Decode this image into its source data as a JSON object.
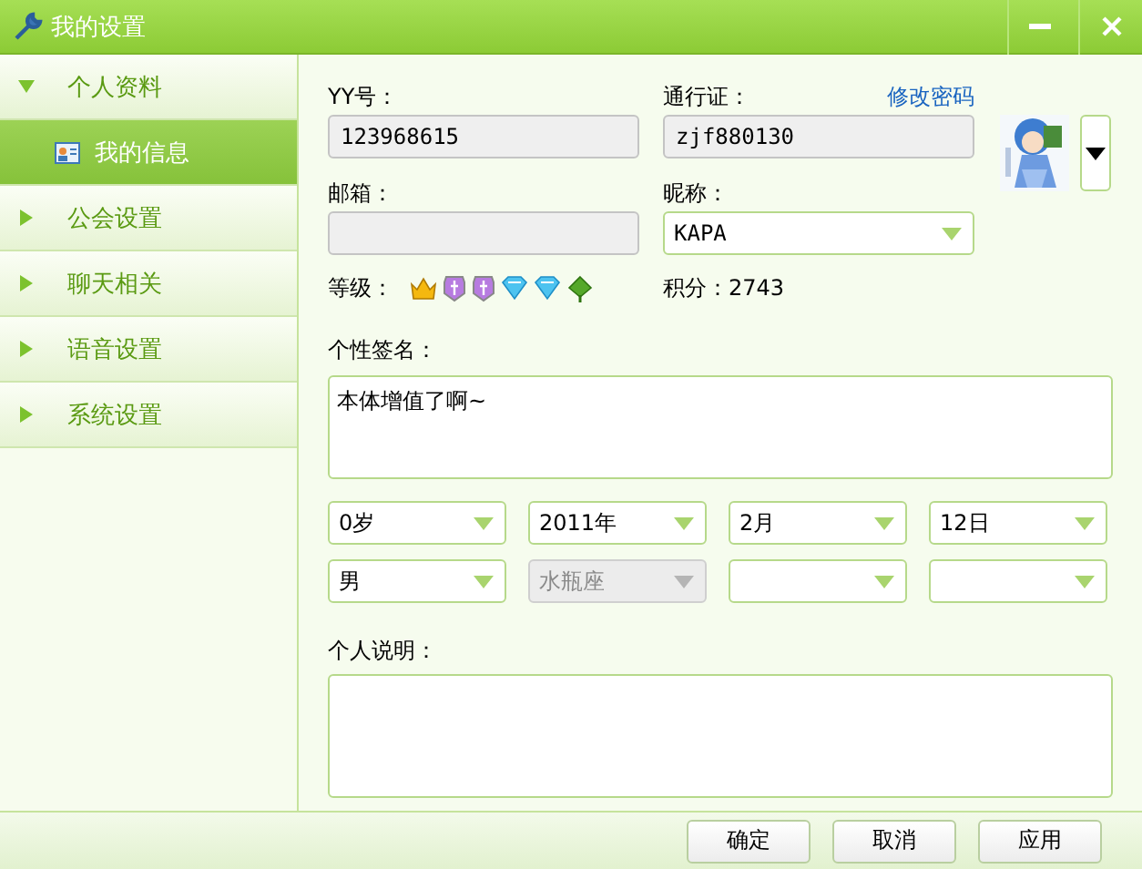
{
  "window": {
    "title": "我的设置"
  },
  "sidebar": {
    "items": [
      {
        "label": "个人资料",
        "expanded": true,
        "children": [
          {
            "label": "我的信息",
            "selected": true
          }
        ]
      },
      {
        "label": "公会设置",
        "expanded": false
      },
      {
        "label": "聊天相关",
        "expanded": false
      },
      {
        "label": "语音设置",
        "expanded": false
      },
      {
        "label": "系统设置",
        "expanded": false
      }
    ]
  },
  "profile": {
    "yy_label": "YY号：",
    "yy_value": "123968615",
    "passport_label": "通行证：",
    "change_password": "修改密码",
    "passport_value": "zjf880130",
    "email_label": "邮箱：",
    "nickname_label": "昵称：",
    "nickname_value": "KAPA",
    "level_label": "等级：",
    "level_badges": [
      {
        "kind": "crown"
      },
      {
        "kind": "shield"
      },
      {
        "kind": "shield"
      },
      {
        "kind": "diamond"
      },
      {
        "kind": "diamond"
      },
      {
        "kind": "leaf"
      }
    ],
    "points": "积分：2743",
    "signature_label": "个性签名：",
    "signature_value": "本体增值了啊~",
    "selects": [
      {
        "value": "0岁",
        "disabled": false
      },
      {
        "value": "2011年",
        "disabled": false
      },
      {
        "value": "2月",
        "disabled": false
      },
      {
        "value": "12日",
        "disabled": false
      },
      {
        "value": "男",
        "disabled": false
      },
      {
        "value": "水瓶座",
        "disabled": true
      },
      {
        "disabled": false
      },
      {
        "disabled": false
      }
    ],
    "description_label": "个人说明："
  },
  "buttons": [
    "确定",
    "取消",
    "应用"
  ]
}
